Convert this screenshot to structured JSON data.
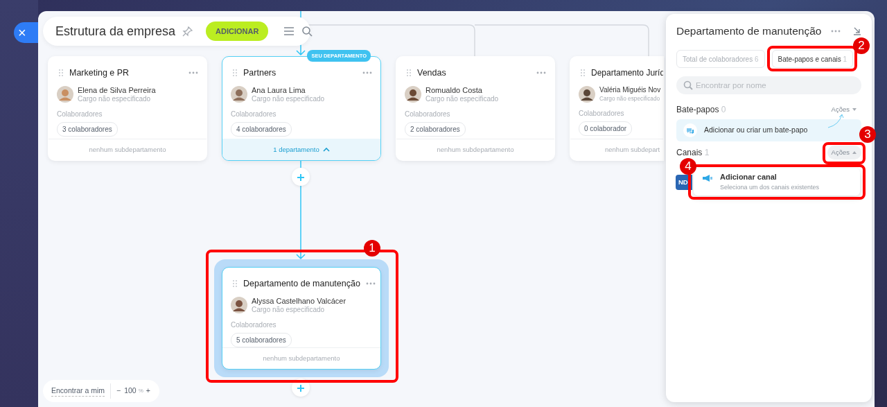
{
  "close_button": {
    "label": "×"
  },
  "header": {
    "title": "Estrutura da empresa",
    "add_button": "ADICIONAR"
  },
  "departments": [
    {
      "kind": "leaf",
      "title": "Marketing e PR",
      "head": "Elena de Silva Perreira",
      "position": "Cargo não especificado",
      "members_label": "Colaboradores",
      "members": "3 colaboradores",
      "footer": "nenhum subdepartamento",
      "selected": false
    },
    {
      "kind": "parent",
      "title": "Partners",
      "head": "Ana Laura Lima",
      "position": "Cargo não especificado",
      "members_label": "Colaboradores",
      "members": "4 colaboradores",
      "footer": "1 departamento",
      "expanded": true,
      "badge": "SEU DEPARTAMENTO",
      "selected": false
    },
    {
      "kind": "leaf",
      "title": "Vendas",
      "head": "Romualdo Costa",
      "position": "Cargo não especificado",
      "members_label": "Colaboradores",
      "members": "2 colaboradores",
      "footer": "nenhum subdepartamento",
      "selected": false
    },
    {
      "kind": "leaf",
      "title": "Departamento Juríd",
      "head": "Valéria Miguéis Nov",
      "position": "Cargo não especificado",
      "members_label": "Colaboradores",
      "members": "0 colaborador",
      "footer": "nenhum subdepart",
      "selected": false
    },
    {
      "kind": "leaf",
      "title": "Departamento de manutenção",
      "head": "Alyssa Castelhano Valcácer",
      "position": "Cargo não especificado",
      "members_label": "Colaboradores",
      "members": "5 colaboradores",
      "footer": "nenhum subdepartamento",
      "selected": true
    }
  ],
  "zoom_bar": {
    "find_me": "Encontrar a mim",
    "minus": "−",
    "zoom": "100",
    "unit": "%",
    "plus": "+"
  },
  "panel": {
    "title": "Departamento de manutenção",
    "tabs": [
      {
        "label": "Total de colaboradores",
        "count": "6",
        "selected": false
      },
      {
        "label": "Bate-papos e canais",
        "count": "1",
        "selected": true
      }
    ],
    "search": {
      "placeholder": "Encontrar por nome"
    },
    "chats": {
      "title": "Bate-papos",
      "count": "0",
      "actions": "Ações",
      "actions_open": false,
      "add_text": "Adicionar ou criar um bate-papo"
    },
    "channels": {
      "title": "Canais",
      "count": "1",
      "actions": "Ações",
      "actions_open": true,
      "avatar": "ND"
    },
    "dropdown": {
      "title": "Adicionar canal",
      "subtitle": "Seleciona um dos canais existentes"
    }
  },
  "annotations": [
    {
      "label": "1"
    },
    {
      "label": "2"
    },
    {
      "label": "3"
    },
    {
      "label": "4"
    }
  ]
}
